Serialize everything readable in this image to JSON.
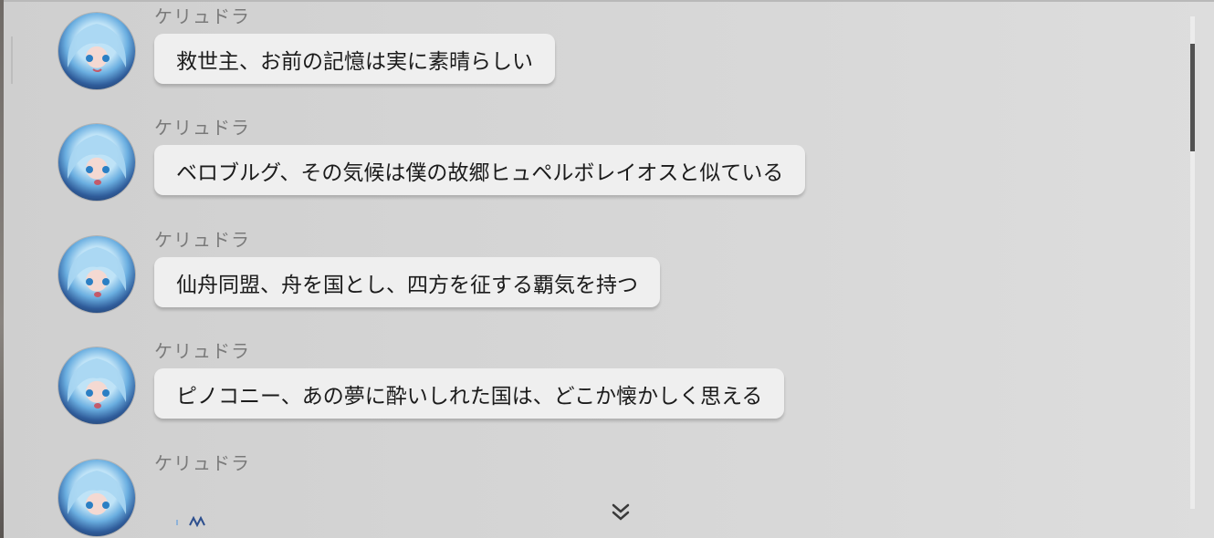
{
  "messages": [
    {
      "sender": "ケリュドラ",
      "text": "救世主、お前の記憶は実に素晴らしい"
    },
    {
      "sender": "ケリュドラ",
      "text": "ベロブルグ、その気候は僕の故郷ヒュペルボレイオスと似ている"
    },
    {
      "sender": "ケリュドラ",
      "text": "仙舟同盟、舟を国とし、四方を征する覇気を持つ"
    },
    {
      "sender": "ケリュドラ",
      "text": "ピノコニー、あの夢に酔いしれた国は、どこか懐かしく思える"
    },
    {
      "sender": "ケリュドラ",
      "text": ""
    }
  ],
  "icons": {
    "avatar": "character-avatar",
    "scroll": "double-chevron-down-icon"
  },
  "colors": {
    "bubble": "#efefef",
    "sender": "#7a7a7a",
    "scrollbar_thumb": "#525252"
  }
}
